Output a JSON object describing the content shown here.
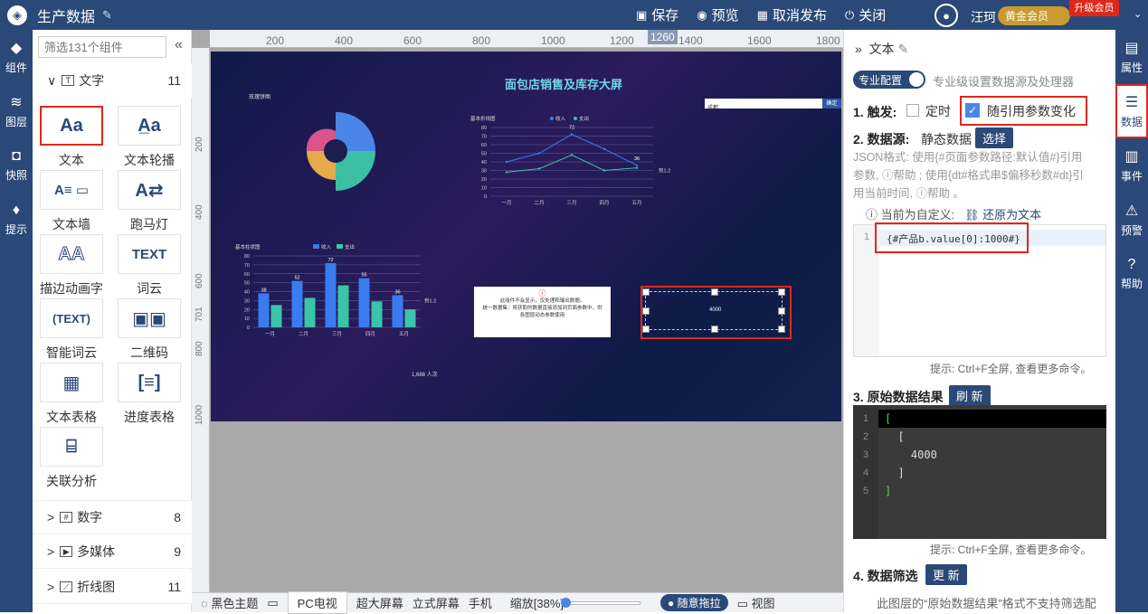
{
  "topbar": {
    "title": "生产数据",
    "save": "保存",
    "preview": "预览",
    "unpublish": "取消发布",
    "close": "关闭",
    "user": "汪珂",
    "member": "黄金会员",
    "upgrade": "升级会员"
  },
  "lside": [
    {
      "label": "组件",
      "icon": "component-icon"
    },
    {
      "label": "图层",
      "icon": "layers-icon"
    },
    {
      "label": "快照",
      "icon": "camera-icon"
    },
    {
      "label": "提示",
      "icon": "bulb-icon"
    }
  ],
  "panel": {
    "search_placeholder": "筛选131个组件",
    "text_section": {
      "label": "文字",
      "count": "11"
    },
    "components": [
      "文本",
      "文本轮播",
      "文本墙",
      "跑马灯",
      "描边动画字",
      "词云",
      "智能词云",
      "二维码",
      "文本表格",
      "进度表格",
      "关联分析"
    ],
    "sections": [
      {
        "label": "数字",
        "count": "8"
      },
      {
        "label": "多媒体",
        "count": "9"
      },
      {
        "label": "折线图",
        "count": "11"
      }
    ]
  },
  "ruler": {
    "h_marks": [
      "200",
      "400",
      "600",
      "800",
      "1000",
      "1200",
      "1260",
      "1400",
      "1600",
      "1800"
    ],
    "v_marks": [
      "200",
      "400",
      "600",
      "701",
      "800",
      "1000"
    ]
  },
  "screen": {
    "title": "面包店销售及库存大屏",
    "top_left_text": "玫瑰饼图",
    "search_text": "成都",
    "search_btn": "确定",
    "line_title": "基本折线图",
    "bar_title": "基本柱状图",
    "legend": [
      "收入",
      "支出"
    ],
    "months": [
      "一月",
      "二月",
      "三月",
      "四月",
      "五月"
    ],
    "line_y": [
      "80",
      "70",
      "60",
      "50",
      "40",
      "30",
      "20",
      "10",
      "0"
    ],
    "line_badges": [
      "72",
      "36"
    ],
    "line_end_label": "到1.2",
    "bar_y": [
      "80",
      "70",
      "60",
      "50",
      "40",
      "30",
      "20",
      "10",
      "0"
    ],
    "bar_labels": [
      "38",
      "52",
      "72",
      "55",
      "36"
    ],
    "bar_end_label": "到1.2",
    "tip_line1": "此组件不会显示，仅处理和输出数据。",
    "tip_line2": "统一数据集：将获取的数据直接添加到页面参数中，供",
    "tip_line3": "各图层动态参数使用",
    "selected_value": "4000",
    "people": "1,688 人次"
  },
  "chart_data": [
    {
      "type": "line",
      "title": "基本折线图",
      "categories": [
        "一月",
        "二月",
        "三月",
        "四月",
        "五月"
      ],
      "ylim": [
        0,
        80
      ],
      "series": [
        {
          "name": "收入",
          "values": [
            40,
            50,
            72,
            55,
            36
          ]
        },
        {
          "name": "支出",
          "values": [
            28,
            32,
            48,
            30,
            33
          ]
        }
      ]
    },
    {
      "type": "bar",
      "title": "基本柱状图",
      "categories": [
        "一月",
        "二月",
        "三月",
        "四月",
        "五月"
      ],
      "ylim": [
        0,
        80
      ],
      "series": [
        {
          "name": "收入",
          "values": [
            38,
            52,
            72,
            55,
            36
          ]
        },
        {
          "name": "支出",
          "values": [
            25,
            33,
            47,
            29,
            20
          ]
        }
      ]
    }
  ],
  "bottombar": {
    "theme": "黑色主题",
    "tabs": [
      "PC电视",
      "超大屏幕",
      "立式屏幕",
      "手机"
    ],
    "zoom": "缩放[38%]",
    "drag": "随意拖拉",
    "view": "视图"
  },
  "rpanel": {
    "title": "文本",
    "pro_label": "专业配置",
    "pro_desc": "专业级设置数据源及处理器",
    "s1": "1. 触发:",
    "timer": "定时",
    "param_change": "随引用参数变化",
    "s2": "2. 数据源:",
    "source": "静态数据",
    "choose": "选择",
    "json_desc1": "JSON格式:  使用{#页面参数路径:默认值#}引用",
    "json_desc2": "参数, ⓘ帮助 ;  使用{dt#格式串$偏移秒数#dt}引",
    "json_desc3": "用当前时间, ⓘ帮助 。",
    "custom": "ⓘ 当前为自定义:",
    "restore": "还原为文本",
    "code_value": "{#产品b.value[0]:1000#}",
    "hint1": "提示: Ctrl+F全屏,  查看更多命令。",
    "s3": "3. 原始数据结果",
    "refresh": "刷 新",
    "result_lines": [
      "[",
      "  [",
      "    4000",
      "  ]",
      "]"
    ],
    "hint2": "提示: Ctrl+F全屏,  查看更多命令。",
    "s4": "4. 数据筛选",
    "refresh2": "更 新",
    "filter_note": "此图层的“原始数据结果”格式不支持筛选配"
  },
  "rside": [
    {
      "label": "属性",
      "icon": "properties-icon"
    },
    {
      "label": "数据",
      "icon": "database-icon"
    },
    {
      "label": "事件",
      "icon": "event-icon"
    },
    {
      "label": "预警",
      "icon": "alarm-icon"
    },
    {
      "label": "帮助",
      "icon": "help-icon"
    }
  ],
  "colors": {
    "primary": "#2b4978",
    "highlight": "#e0271b",
    "bar_income": "#3b7bf0",
    "bar_expense": "#39c5a8"
  }
}
